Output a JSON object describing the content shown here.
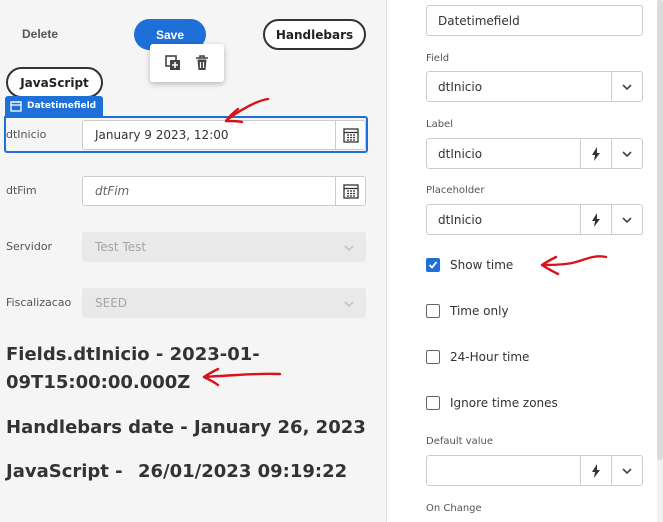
{
  "toolbar": {
    "delete_label": "Delete",
    "save_label": "Save",
    "handlebars_label": "Handlebars",
    "javascript_label": "JavaScript"
  },
  "popover": {
    "copy_icon": "copy-icon",
    "delete_icon": "trash-icon"
  },
  "selected_tag": {
    "label": "Datetimefield",
    "icon": "calendar-icon"
  },
  "form": {
    "fields": [
      {
        "label": "dtInicio",
        "value": "January 9 2023, 12:00",
        "kind": "datetime"
      },
      {
        "label": "dtFim",
        "placeholder": "dtFim",
        "kind": "datetime"
      },
      {
        "label": "Servidor",
        "value": "Test Test",
        "kind": "select-disabled"
      },
      {
        "label": "Fiscalizacao",
        "value": "SEED",
        "kind": "select-disabled"
      }
    ]
  },
  "output": {
    "line1": "Fields.dtInicio - 2023-01-",
    "line2": "09T15:00:00.000Z",
    "line3": "Handlebars date - January 26, 2023",
    "line4_prefix": "JavaScript -",
    "line4_value": "26/01/2023 09:19:22"
  },
  "properties": {
    "name_value": "Datetimefield",
    "field_label": "Field",
    "field_value": "dtInicio",
    "label_label": "Label",
    "label_value": "dtInicio",
    "placeholder_label": "Placeholder",
    "placeholder_value": "dtInicio",
    "show_time": {
      "label": "Show time",
      "checked": true
    },
    "time_only": {
      "label": "Time only",
      "checked": false
    },
    "hour24": {
      "label": "24-Hour time",
      "checked": false
    },
    "ignore_tz": {
      "label": "Ignore time zones",
      "checked": false
    },
    "default_value_label": "Default value",
    "default_value": "",
    "on_change_label": "On Change"
  },
  "colors": {
    "accent": "#1f6fd9",
    "annotation": "#d8121b",
    "canvas_bg": "#f5f5f5"
  }
}
